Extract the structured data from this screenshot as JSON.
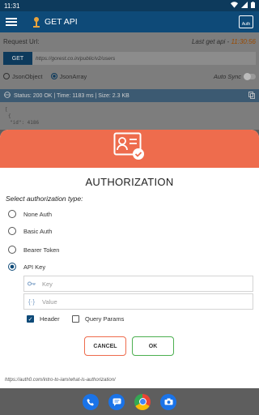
{
  "status_bar": {
    "time": "11:31"
  },
  "app_bar": {
    "title": "GET API",
    "auth_label": "Auth"
  },
  "request": {
    "label": "Request Url:",
    "last_prefix": "Last get api - ",
    "last_time": "11:30:56",
    "method_button": "GET",
    "url": "https://gorest.co.in/public/v2/users",
    "json_object": "JsonObject",
    "json_array": "JsonArray",
    "auto_sync": "Auto Sync",
    "status_line": "Status: 200 OK | Time: 1183 ms | Size: 2.3 KB",
    "code_line1": "[",
    "code_line2": "  {",
    "code_line3": "    \"id\": 4186"
  },
  "dialog": {
    "title": "AUTHORIZATION",
    "subtitle": "Select authorization type:",
    "options": [
      "None Auth",
      "Basic Auth",
      "Bearer Token",
      "API Key"
    ],
    "selected_option": "API Key",
    "key_placeholder": "Key",
    "value_placeholder": "Value",
    "header_label": "Header",
    "header_checked": true,
    "query_label": "Query Params",
    "query_checked": false,
    "cancel_label": "CANCEL",
    "ok_label": "OK",
    "link": "https://auth0.com/intro-to-iam/what-is-authorization/"
  },
  "nav_apps": [
    "phone-icon",
    "messages-icon",
    "chrome-icon",
    "camera-icon"
  ],
  "colors": {
    "header_orange": "#ee6c4d",
    "primary_blue": "#0e4a78",
    "ok_green": "#4caf50"
  }
}
